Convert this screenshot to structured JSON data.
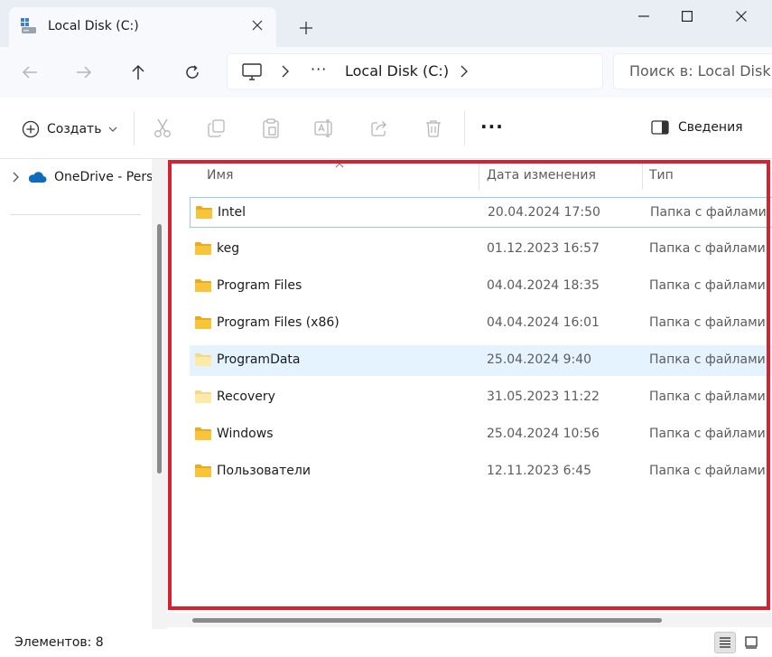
{
  "window": {
    "tab_title": "Local Disk (C:)",
    "new_tab_symbol": "+"
  },
  "address": {
    "overflow": "···",
    "crumb": "Local Disk (C:)"
  },
  "search": {
    "placeholder": "Поиск в: Local Disk"
  },
  "commandbar": {
    "create_label": "Создать",
    "more": "···",
    "details_label": "Сведения"
  },
  "nav": {
    "onedrive_label": "OneDrive - Pers"
  },
  "columns": {
    "name": "Имя",
    "date": "Дата изменения",
    "type": "Тип"
  },
  "files": [
    {
      "name": "Intel",
      "date": "20.04.2024 17:50",
      "type": "Папка с файлами",
      "faded": false
    },
    {
      "name": "keg",
      "date": "01.12.2023 16:57",
      "type": "Папка с файлами",
      "faded": false
    },
    {
      "name": "Program Files",
      "date": "04.04.2024 18:35",
      "type": "Папка с файлами",
      "faded": false
    },
    {
      "name": "Program Files (x86)",
      "date": "04.04.2024 16:01",
      "type": "Папка с файлами",
      "faded": false
    },
    {
      "name": "ProgramData",
      "date": "25.04.2024 9:40",
      "type": "Папка с файлами",
      "faded": true
    },
    {
      "name": "Recovery",
      "date": "31.05.2023 11:22",
      "type": "Папка с файлами",
      "faded": true
    },
    {
      "name": "Windows",
      "date": "25.04.2024 10:56",
      "type": "Папка с файлами",
      "faded": false
    },
    {
      "name": "Пользователи",
      "date": "12.11.2023 6:45",
      "type": "Папка с файлами",
      "faded": false
    }
  ],
  "status": {
    "count": "Элементов: 8"
  },
  "colors": {
    "accent_frame": "#d8202f",
    "folder": "#f8c53a",
    "hover_row": "#e5f3ff"
  }
}
